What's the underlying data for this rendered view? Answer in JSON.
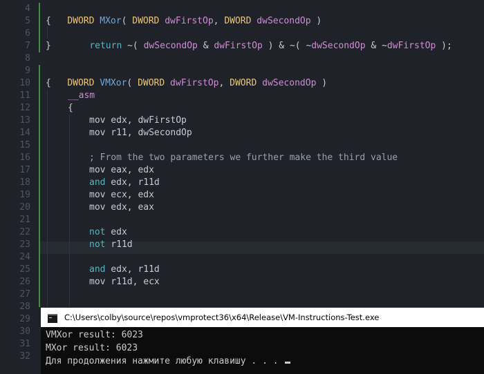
{
  "editor": {
    "line_numbers": [
      "4",
      "5",
      "6",
      "7",
      "8",
      "9",
      "10",
      "11",
      "12",
      "13",
      "14",
      "15",
      "16",
      "17",
      "18",
      "19",
      "20",
      "21",
      "22",
      "23",
      "24",
      "25",
      "26",
      "27",
      "28",
      "29",
      "30",
      "31",
      "32"
    ],
    "tokens": {
      "dword": "DWORD",
      "mxor": "MXor",
      "vmxor": "VMXor",
      "paren_open": "( ",
      "paren_close": " )",
      "comma": ", ",
      "dwFirstOp": "dwFirstOp",
      "dwSecondOp": "dwSecondOp",
      "brace_open": "{",
      "brace_close": "}",
      "return_kw": "return",
      "asm_kw": "__asm",
      "not_kw": "not",
      "and_kw": "and"
    },
    "return_line": {
      "a": " ~( ",
      "b": " & ",
      "c": " ) & ~( ",
      "d": "~",
      "e": " & ~",
      "f": " );"
    },
    "asm_lines": {
      "l13": "mov edx, dwFirstOp",
      "l14": "mov r11, dwSecondOp",
      "l16": "; From the two parameters we further make the third value",
      "l17": "mov eax, edx",
      "l18_rest": " edx, r11d",
      "l19": "mov ecx, edx",
      "l20": "mov edx, eax",
      "l22_rest": " edx",
      "l23_rest": " r11d",
      "l25_rest": " edx, r11d",
      "l26": "mov r11d, ecx"
    }
  },
  "console": {
    "title": "C:\\Users\\colby\\source\\repos\\vmprotect36\\x64\\Release\\VM-Instructions-Test.exe",
    "lines": [
      "VMXor result: 6023",
      "MXor result: 6023",
      "Для продолжения нажмите любую клавишу . . . "
    ]
  },
  "colors": {
    "background": "#1f2228",
    "type": "#f0c674",
    "function": "#6fa8dc",
    "parameter": "#d28bd8",
    "keyword": "#56b6c2",
    "line_number": "#4e5563",
    "console_bg": "#0c0c0c",
    "console_text": "#cccccc"
  }
}
